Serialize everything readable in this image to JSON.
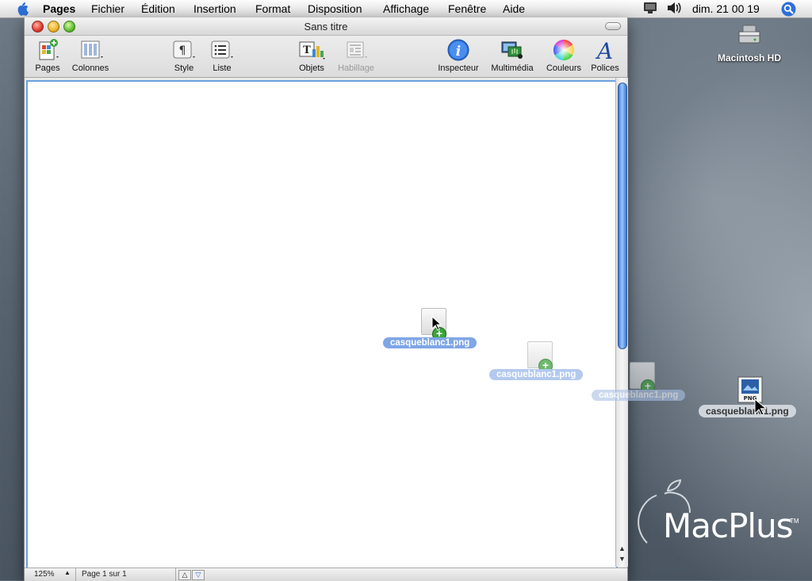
{
  "menubar": {
    "app": "Pages",
    "menus": [
      "Fichier",
      "Édition",
      "Insertion",
      "Format",
      "Disposition",
      "Affichage",
      "Fenêtre",
      "Aide"
    ],
    "clock": "dim. 21 00 19",
    "icons": [
      "display-icon",
      "volume-icon",
      "spotlight-icon"
    ]
  },
  "window": {
    "title": "Sans titre",
    "toolbar": {
      "pages": "Pages",
      "columns": "Colonnes",
      "style": "Style",
      "list": "Liste",
      "objects": "Objets",
      "wrap": "Habillage",
      "inspector": "Inspecteur",
      "media": "Multimédia",
      "colors": "Couleurs",
      "fonts": "Polices"
    },
    "status": {
      "zoom": "125%",
      "page": "Page 1 sur 1"
    }
  },
  "drag": {
    "filename": "casqueblanc1.png"
  },
  "desktop": {
    "hd_label": "Macintosh HD",
    "file_label": "casqueblanc1.png",
    "file_type": "PNG",
    "logo": "MacPlus",
    "logo_tm": "TM"
  },
  "colors": {
    "selection": "#6aa0e0",
    "scroll_thumb": "#3c77d1",
    "plus_badge": "#3ba33b"
  }
}
